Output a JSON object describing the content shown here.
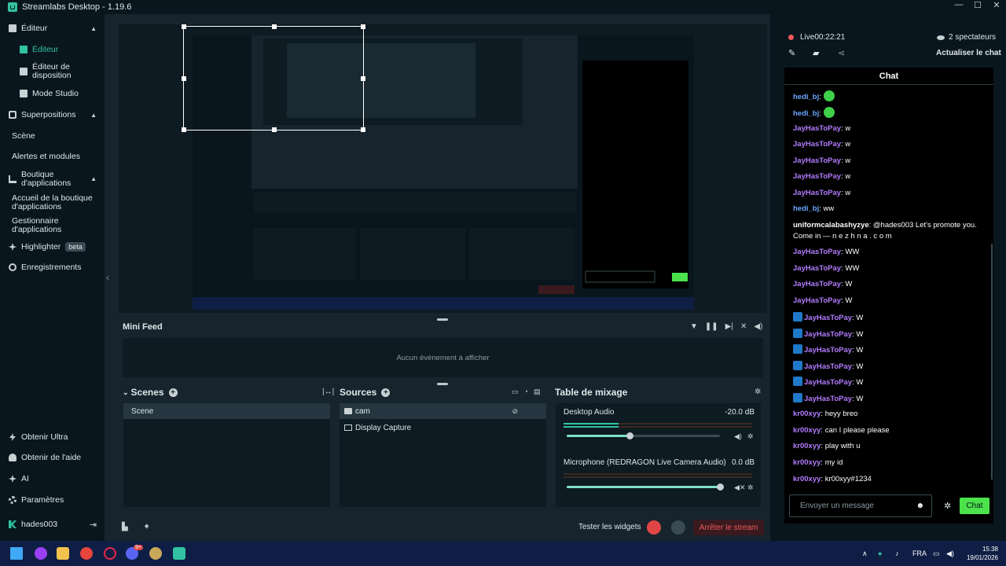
{
  "window": {
    "title": "Streamlabs Desktop - 1.19.6",
    "controls": [
      "—",
      "☐",
      "✕"
    ]
  },
  "sidebar": {
    "items": [
      {
        "label": "Éditeur",
        "icon": "editor-icon"
      },
      {
        "label": "Éditeur",
        "icon": "editor-icon"
      },
      {
        "label": "Éditeur de disposition",
        "icon": "layout-icon"
      },
      {
        "label": "Mode Studio",
        "icon": "studio-icon"
      },
      {
        "label": "Superpositions",
        "icon": "overlays-icon"
      },
      {
        "label": "Scène",
        "icon": ""
      },
      {
        "label": "Alertes et modules",
        "icon": ""
      },
      {
        "label": "Boutique d'applications",
        "icon": "app-store-icon"
      },
      {
        "label": "Accueil de la boutique d'applications",
        "icon": ""
      },
      {
        "label": "Gestionnaire d'applications",
        "icon": ""
      },
      {
        "label": "Highlighter",
        "badge": "beta",
        "icon": "highlighter-icon"
      },
      {
        "label": "Enregistrements",
        "icon": "recordings-icon"
      }
    ],
    "bottom": [
      {
        "label": "Obtenir Ultra"
      },
      {
        "label": "Obtenir de l'aide"
      },
      {
        "label": "AI"
      },
      {
        "label": "Paramètres"
      },
      {
        "label": "hades003"
      }
    ]
  },
  "minifeed": {
    "title": "Mini Feed",
    "empty": "Aucun événement à afficher"
  },
  "scenes": {
    "title": "Scenes",
    "items": [
      "Scene"
    ]
  },
  "sources": {
    "title": "Sources",
    "items": [
      "cam",
      "Display Capture"
    ]
  },
  "mixer": {
    "title": "Table de mixage",
    "channels": [
      {
        "name": "Desktop Audio",
        "db": "-20.0 dB",
        "level": 0.41
      },
      {
        "name": "Microphone (REDRAGON Live Camera Audio)",
        "db": "0.0 dB",
        "level": 1.0
      }
    ]
  },
  "footer": {
    "test_widgets": "Tester les widgets",
    "stop_stream": "Arrêter le stream"
  },
  "live": {
    "status": "Live",
    "time": "00:22:21",
    "viewers": "2 spectateurs",
    "refresh": "Actualiser le chat"
  },
  "chat": {
    "title": "Chat",
    "messages": [
      {
        "user": "hedi_bj",
        "text": "",
        "emote": true,
        "color": "blue"
      },
      {
        "user": "hedi_bj",
        "text": "",
        "emote": true,
        "color": "blue"
      },
      {
        "user": "JayHasToPay",
        "text": "w",
        "color": "purple"
      },
      {
        "user": "JayHasToPay",
        "text": "w",
        "color": "purple"
      },
      {
        "user": "JayHasToPay",
        "text": "w",
        "color": "purple"
      },
      {
        "user": "JayHasToPay",
        "text": "w",
        "color": "purple"
      },
      {
        "user": "JayHasToPay",
        "text": "w",
        "color": "purple"
      },
      {
        "user": "hedi_bj",
        "text": "ww",
        "color": "blue"
      },
      {
        "user": "uniformcalabashyzye",
        "text": "@hades003 Let's promote you. Come in — n e z h n a . c o m",
        "color": "white"
      },
      {
        "user": "JayHasToPay",
        "text": "WW",
        "color": "purple"
      },
      {
        "user": "JayHasToPay",
        "text": "WW",
        "color": "purple"
      },
      {
        "user": "JayHasToPay",
        "text": "W",
        "color": "purple"
      },
      {
        "user": "JayHasToPay",
        "text": "W",
        "color": "purple"
      },
      {
        "user": "JayHasToPay",
        "text": "W",
        "color": "purple",
        "pfp": true
      },
      {
        "user": "JayHasToPay",
        "text": "W",
        "color": "purple",
        "pfp": true
      },
      {
        "user": "JayHasToPay",
        "text": "W",
        "color": "purple",
        "pfp": true
      },
      {
        "user": "JayHasToPay",
        "text": "W",
        "color": "purple",
        "pfp": true
      },
      {
        "user": "JayHasToPay",
        "text": "W",
        "color": "purple",
        "pfp": true
      },
      {
        "user": "JayHasToPay",
        "text": "W",
        "color": "purple",
        "pfp": true
      },
      {
        "user": "kr00xyy",
        "text": "heyy breo",
        "color": "purple"
      },
      {
        "user": "kr00xyy",
        "text": "can I please please",
        "color": "purple"
      },
      {
        "user": "kr00xyy",
        "text": "play with u",
        "color": "purple"
      },
      {
        "user": "kr00xyy",
        "text": "my id",
        "color": "purple"
      },
      {
        "user": "kr00xyy",
        "text": "kr00xyy#1234",
        "color": "purple"
      }
    ],
    "input_placeholder": "Envoyer un message",
    "send": "Chat"
  },
  "taskbar": {
    "lang": "FRA",
    "time": "15:38",
    "date": "19/01/2026",
    "badge": "9+"
  },
  "colors": {
    "accent": "#31c3a2",
    "live": "#f05a5a",
    "chat_send": "#4be24b"
  }
}
